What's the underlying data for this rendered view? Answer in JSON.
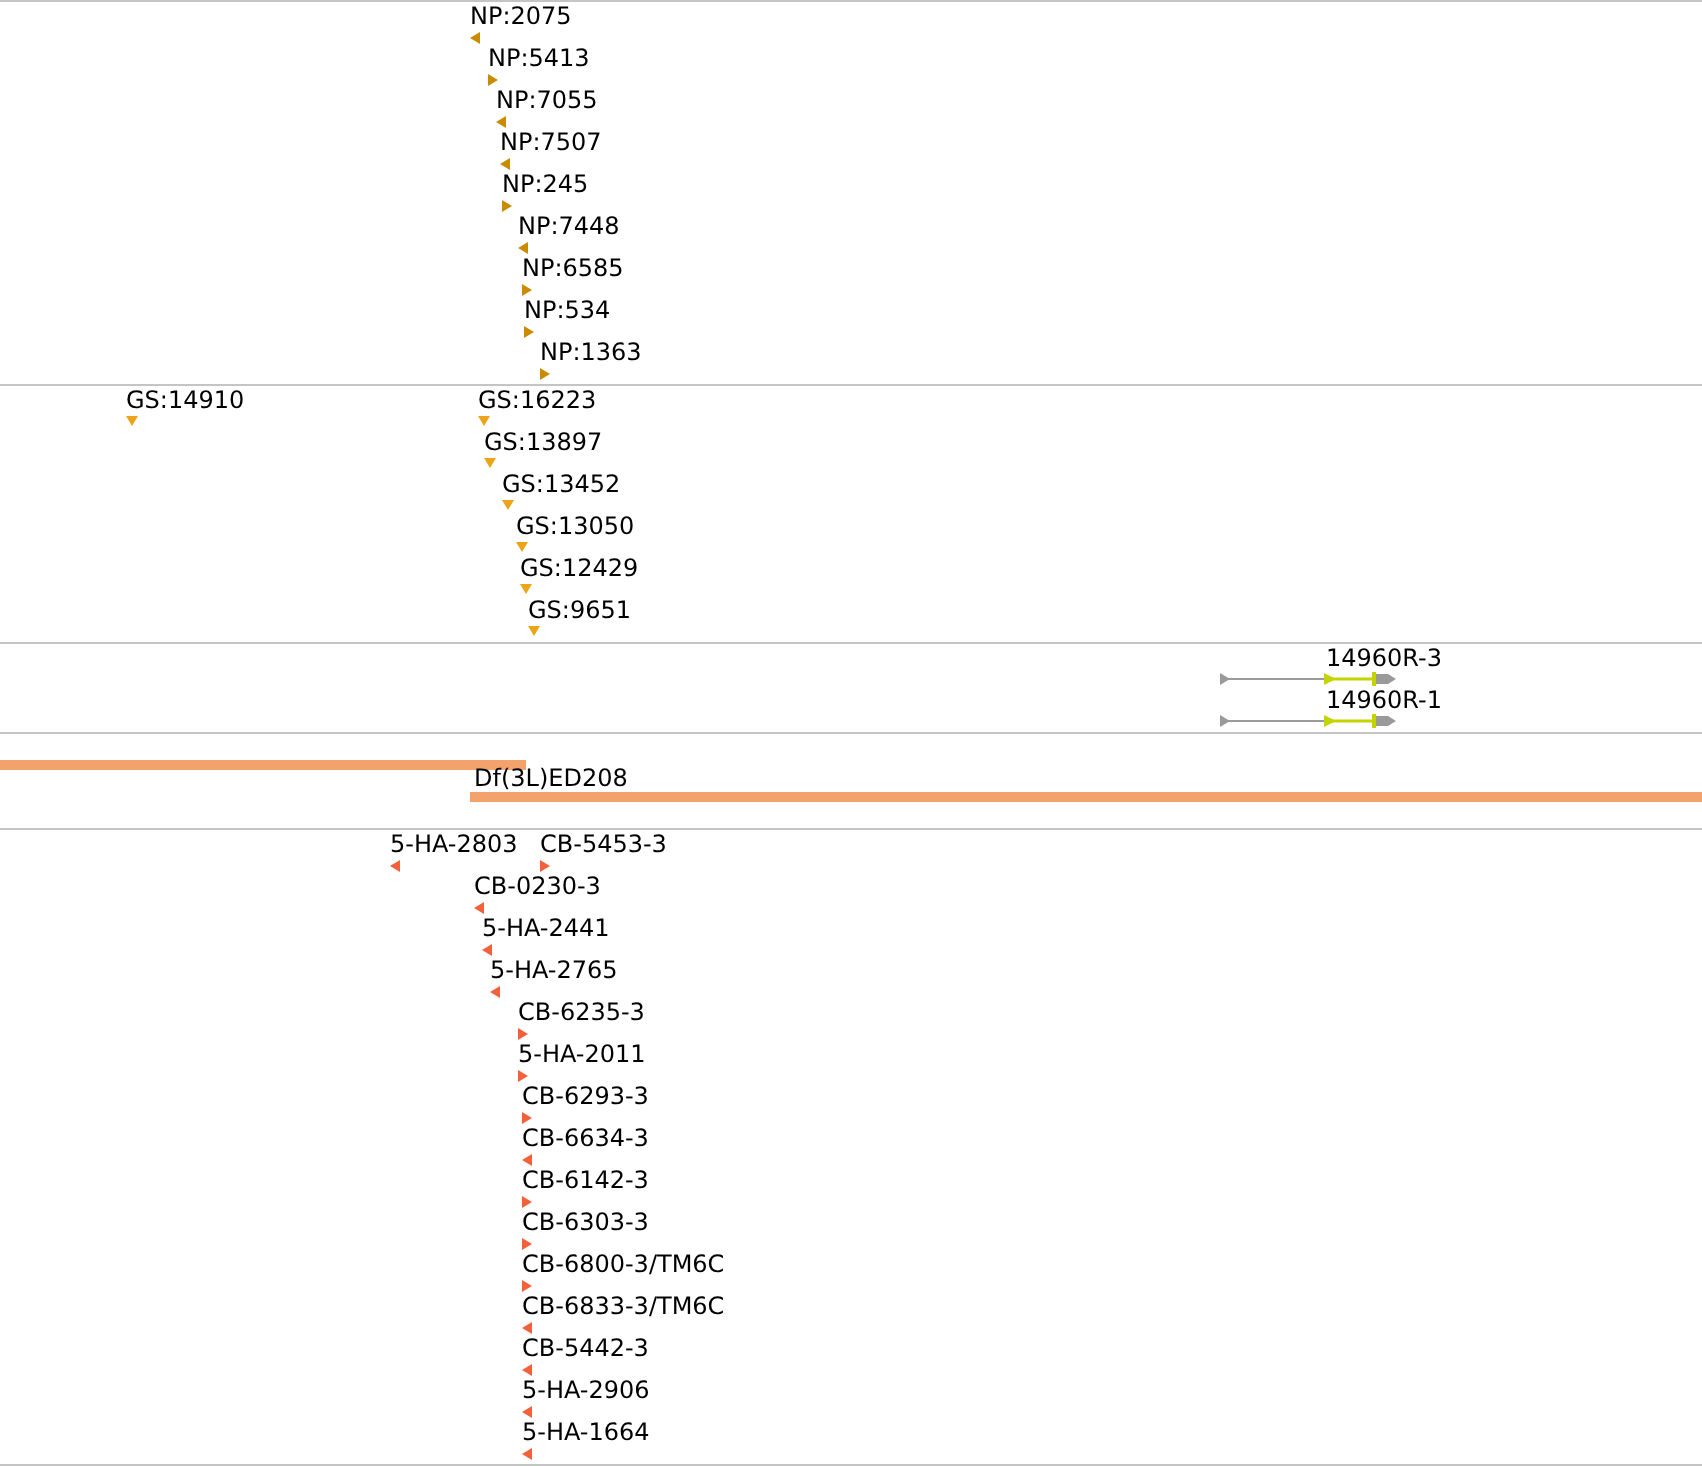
{
  "tracks": [
    {
      "kind": "stranded",
      "color": "#c98c00",
      "features": [
        {
          "label": "NP:2075",
          "reverse": true
        },
        {
          "label": "NP:5413",
          "reverse": false
        },
        {
          "label": "NP:7055",
          "reverse": true
        },
        {
          "label": "NP:7507",
          "reverse": true
        },
        {
          "label": "NP:245",
          "reverse": false
        },
        {
          "label": "NP:7448",
          "reverse": true
        },
        {
          "label": "NP:6585",
          "reverse": false
        },
        {
          "label": "NP:534",
          "reverse": false
        },
        {
          "label": "NP:1363",
          "reverse": false
        }
      ]
    },
    {
      "kind": "unstranded",
      "color": "#eca41a",
      "features": [
        {
          "label": "GS:14910"
        },
        {
          "label": "GS:16223"
        },
        {
          "label": "GS:13897"
        },
        {
          "label": "GS:13452"
        },
        {
          "label": "GS:13050"
        },
        {
          "label": "GS:12429"
        },
        {
          "label": "GS:9651"
        }
      ]
    },
    {
      "kind": "transcripts",
      "features": [
        {
          "label": "14960R-3"
        },
        {
          "label": "14960R-1"
        }
      ]
    },
    {
      "kind": "deficiencies",
      "color": "#f4a26c",
      "features": [
        {
          "kind": "bar"
        },
        {
          "kind": "bar",
          "label": "Df(3L)ED208"
        }
      ]
    },
    {
      "kind": "stranded",
      "color": "#f2603c",
      "features": [
        {
          "label": "5-HA-2803",
          "reverse": true
        },
        {
          "label": "CB-5453-3",
          "reverse": false
        },
        {
          "label": "CB-0230-3",
          "reverse": true
        },
        {
          "label": "5-HA-2441",
          "reverse": true
        },
        {
          "label": "5-HA-2765",
          "reverse": true
        },
        {
          "label": "CB-6235-3",
          "reverse": false
        },
        {
          "label": "5-HA-2011",
          "reverse": false
        },
        {
          "label": "CB-6293-3",
          "reverse": false
        },
        {
          "label": "CB-6634-3",
          "reverse": true
        },
        {
          "label": "CB-6142-3",
          "reverse": false
        },
        {
          "label": "CB-6303-3",
          "reverse": false
        },
        {
          "label": "CB-6800-3/TM6C",
          "reverse": false
        },
        {
          "label": "CB-6833-3/TM6C",
          "reverse": true
        },
        {
          "label": "CB-5442-3",
          "reverse": true
        },
        {
          "label": "5-HA-2906",
          "reverse": true
        },
        {
          "label": "5-HA-1664",
          "reverse": true
        }
      ]
    }
  ]
}
